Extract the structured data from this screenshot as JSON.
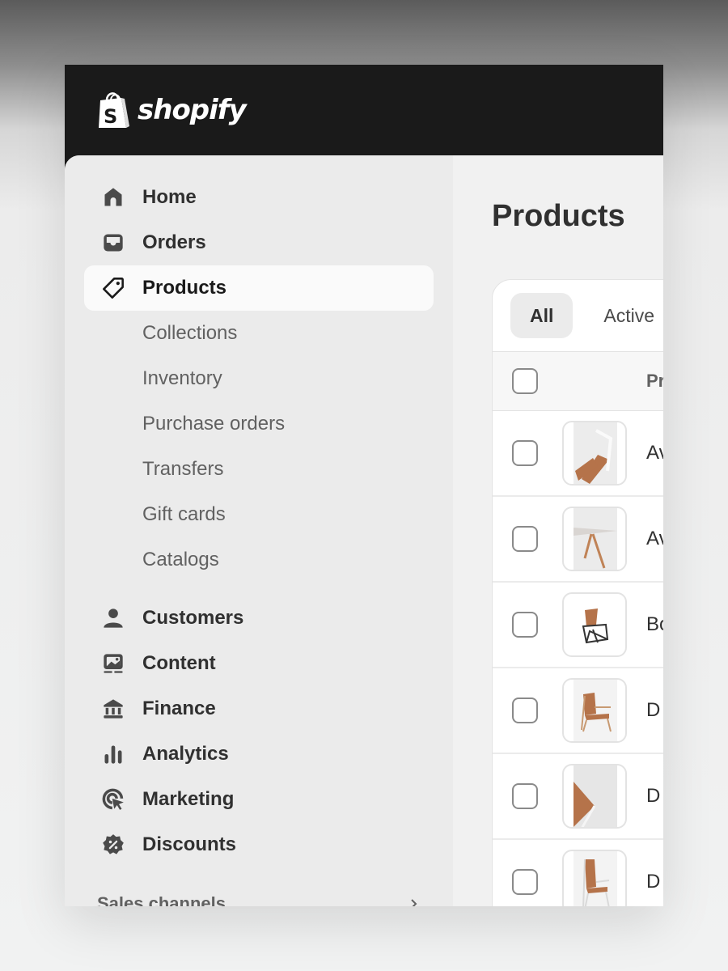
{
  "brand": {
    "name": "shopify",
    "color": "#1a1a1a"
  },
  "sidebar": {
    "items": [
      {
        "label": "Home",
        "icon": "home-icon"
      },
      {
        "label": "Orders",
        "icon": "inbox-icon"
      },
      {
        "label": "Products",
        "icon": "tag-icon",
        "active": true
      }
    ],
    "sub_items": [
      {
        "label": "Collections"
      },
      {
        "label": "Inventory"
      },
      {
        "label": "Purchase orders"
      },
      {
        "label": "Transfers"
      },
      {
        "label": "Gift cards"
      },
      {
        "label": "Catalogs"
      }
    ],
    "items2": [
      {
        "label": "Customers",
        "icon": "person-icon"
      },
      {
        "label": "Content",
        "icon": "image-icon"
      },
      {
        "label": "Finance",
        "icon": "bank-icon"
      },
      {
        "label": "Analytics",
        "icon": "bar-chart-icon"
      },
      {
        "label": "Marketing",
        "icon": "target-icon"
      },
      {
        "label": "Discounts",
        "icon": "discount-badge-icon"
      }
    ],
    "section_label": "Sales channels"
  },
  "main": {
    "title": "Products",
    "tabs": [
      {
        "label": "All",
        "selected": true
      },
      {
        "label": "Active"
      }
    ],
    "table": {
      "header": "Product",
      "rows": [
        {
          "name": "Av",
          "thumb": "chair-folded"
        },
        {
          "name": "Av",
          "thumb": "table"
        },
        {
          "name": "Bo",
          "thumb": "stacked-chairs"
        },
        {
          "name": "D",
          "thumb": "lounge-chair"
        },
        {
          "name": "D",
          "thumb": "chair-closeup"
        },
        {
          "name": "D",
          "thumb": "highback-chair"
        }
      ]
    }
  },
  "colors": {
    "sidebar_bg": "#ebebeb",
    "main_bg": "#f1f1f1",
    "active_item_bg": "#fafafa",
    "text_primary": "#303030",
    "text_secondary": "#616161",
    "leather": "#b5734a"
  }
}
